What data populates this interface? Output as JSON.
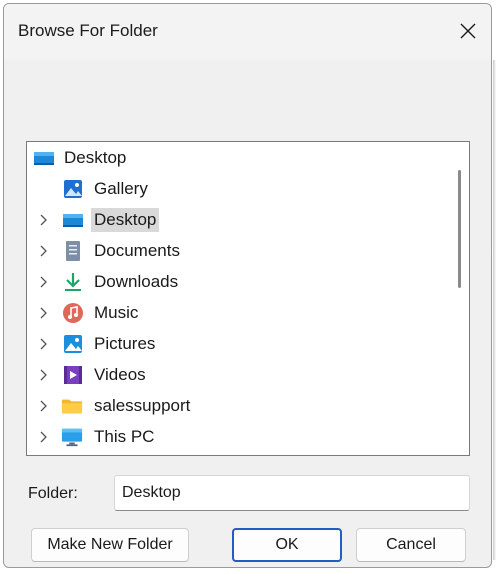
{
  "dialog": {
    "title": "Browse For Folder",
    "close_icon": "close-icon"
  },
  "tree": {
    "root": {
      "label": "Desktop",
      "icon": "desktop-icon"
    },
    "items": [
      {
        "label": "Gallery",
        "icon": "gallery-icon",
        "expandable": false,
        "selected": false
      },
      {
        "label": "Desktop",
        "icon": "desktop-icon",
        "expandable": true,
        "selected": true
      },
      {
        "label": "Documents",
        "icon": "documents-icon",
        "expandable": true,
        "selected": false
      },
      {
        "label": "Downloads",
        "icon": "downloads-icon",
        "expandable": true,
        "selected": false
      },
      {
        "label": "Music",
        "icon": "music-icon",
        "expandable": true,
        "selected": false
      },
      {
        "label": "Pictures",
        "icon": "pictures-icon",
        "expandable": true,
        "selected": false
      },
      {
        "label": "Videos",
        "icon": "videos-icon",
        "expandable": true,
        "selected": false
      },
      {
        "label": "salessupport",
        "icon": "folder-icon",
        "expandable": true,
        "selected": false
      },
      {
        "label": "This PC",
        "icon": "this-pc-icon",
        "expandable": true,
        "selected": false
      }
    ]
  },
  "folder": {
    "label": "Folder:",
    "value": "Desktop"
  },
  "buttons": {
    "make_new_folder": "Make New Folder",
    "ok": "OK",
    "cancel": "Cancel"
  },
  "colors": {
    "selection": "#d9d9d9",
    "default_button_border": "#1f5fbf"
  }
}
